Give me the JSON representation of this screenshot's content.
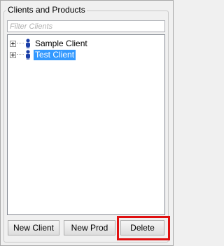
{
  "panel": {
    "title": "Clients and Products"
  },
  "filter": {
    "placeholder": "Filter Clients",
    "value": ""
  },
  "tree": {
    "nodes": [
      {
        "label": "Sample Client",
        "icon": "person-icon",
        "expanded": false,
        "selected": false
      },
      {
        "label": "Test Client",
        "icon": "person-icon",
        "expanded": false,
        "selected": true
      }
    ]
  },
  "buttons": {
    "new_client": "New Client",
    "new_prod": "New Prod",
    "delete": "Delete"
  },
  "colors": {
    "selection": "#3399ff",
    "person_icon": "#1b3fa8",
    "highlight_frame": "#e01010"
  }
}
